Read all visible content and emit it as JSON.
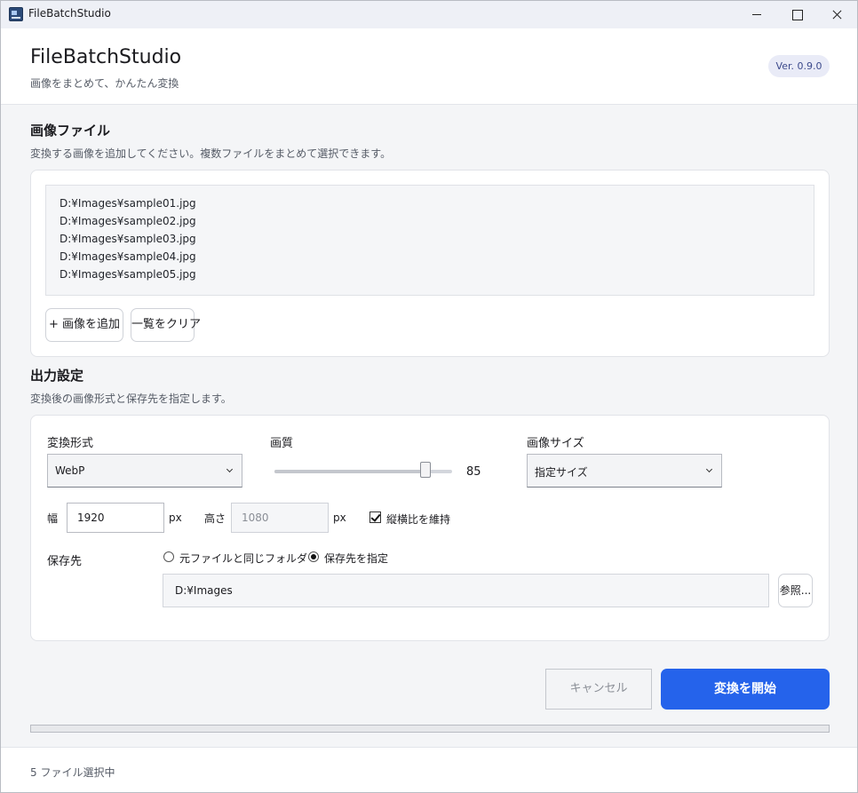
{
  "window": {
    "title": "FileBatchStudio"
  },
  "header": {
    "title": "FileBatchStudio",
    "subtitle": "画像をまとめて、かんたん変換",
    "version": "Ver. 0.9.0"
  },
  "images_section": {
    "title": "画像ファイル",
    "description": "変換する画像を追加してください。複数ファイルをまとめて選択できます。",
    "files": [
      "D:¥Images¥sample01.jpg",
      "D:¥Images¥sample02.jpg",
      "D:¥Images¥sample03.jpg",
      "D:¥Images¥sample04.jpg",
      "D:¥Images¥sample05.jpg"
    ],
    "add_button": "+ 画像を追加",
    "clear_button": "一覧をクリア"
  },
  "output_section": {
    "title": "出力設定",
    "description": "変換後の画像形式と保存先を指定します。",
    "format_label": "変換形式",
    "format_value": "WebP",
    "quality_label": "画質",
    "quality_value": 85,
    "quality_max": 100,
    "size_label": "画像サイズ",
    "size_value": "指定サイズ",
    "width_label": "幅",
    "width_value": "1920",
    "width_unit": "px",
    "height_label": "高さ",
    "height_value": "1080",
    "height_unit": "px",
    "keep_aspect_label": "縦横比を維持",
    "keep_aspect_checked": true,
    "dest_label": "保存先",
    "radio_same_folder": "元ファイルと同じフォルダー",
    "radio_custom": "保存先を指定",
    "selected_destination": "custom",
    "dest_path": "D:¥Images",
    "browse_button": "参照..."
  },
  "actions": {
    "cancel": "キャンセル",
    "start": "変換を開始"
  },
  "progress": {
    "value": 0
  },
  "status": {
    "text": "5 ファイル選択中"
  },
  "colors": {
    "accent": "#2563eb",
    "background": "#f4f5f7"
  }
}
